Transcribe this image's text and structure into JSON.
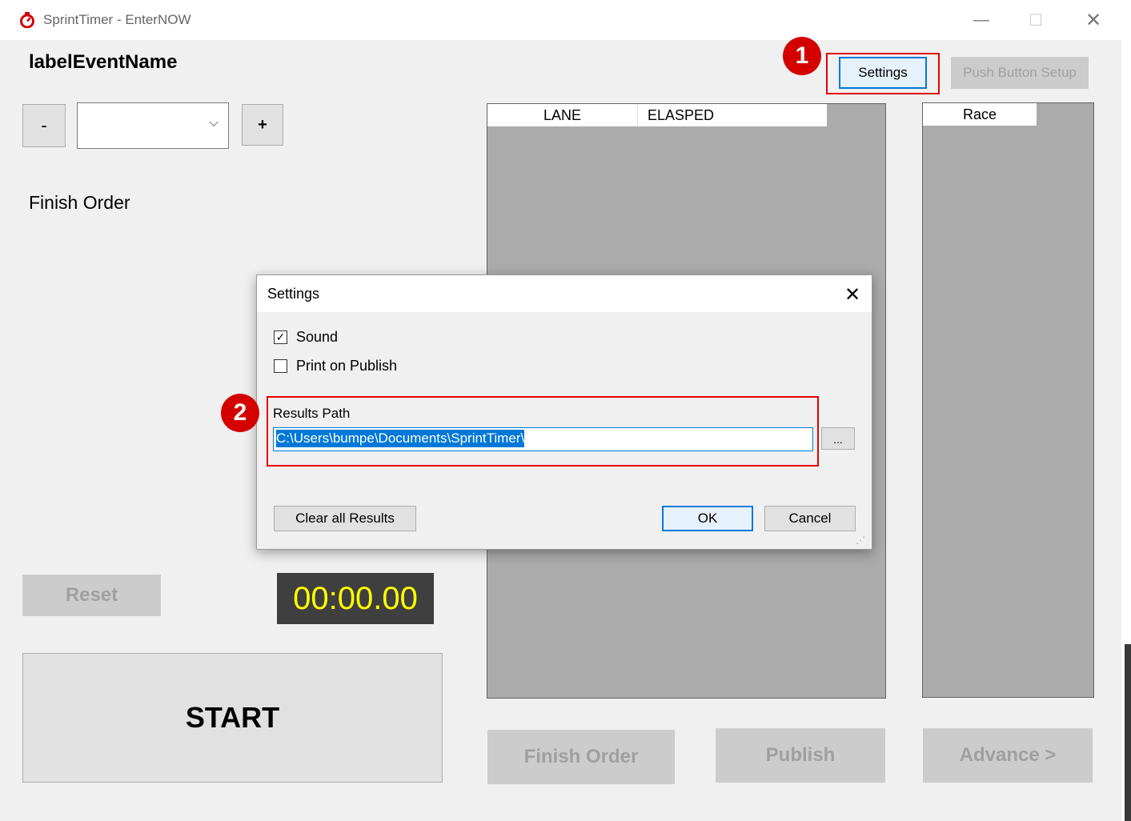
{
  "window": {
    "title": "SprintTimer - EnterNOW",
    "minimize": "—",
    "maximize": "☐",
    "close": "✕"
  },
  "main": {
    "event_name": "labelEventName",
    "minus_label": "-",
    "plus_label": "+",
    "combo_value": "",
    "combo_arrow": "⌵",
    "finish_order_label": "Finish Order",
    "settings_label": "Settings",
    "push_button_setup_label": "Push Button Setup",
    "reset_label": "Reset",
    "timer": "00:00.00",
    "start_label": "START",
    "finish_order_button": "Finish Order",
    "publish_label": "Publish",
    "advance_label": "Advance >"
  },
  "lane_grid": {
    "columns": [
      "LANE",
      "ELASPED"
    ]
  },
  "race_grid": {
    "columns": [
      "Race"
    ]
  },
  "annotations": {
    "badge1": "1",
    "badge2": "2"
  },
  "dialog": {
    "title": "Settings",
    "close": "✕",
    "sound_label": "Sound",
    "sound_checked": true,
    "print_label": "Print on Publish",
    "print_checked": false,
    "results_path_label": "Results Path",
    "results_path_value": "C:\\Users\\bumpe\\Documents\\SprintTimer\\",
    "browse_label": "...",
    "clear_label": "Clear all Results",
    "ok_label": "OK",
    "cancel_label": "Cancel",
    "grip": "⋰"
  },
  "colors": {
    "accent": "#0078d7",
    "annotation_red": "#e30000",
    "timer_fg": "#ffff00",
    "timer_bg": "#3f3f3f"
  }
}
